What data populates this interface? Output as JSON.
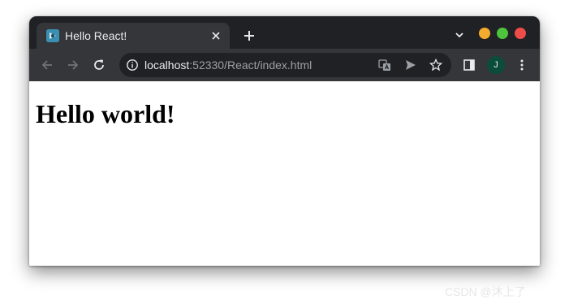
{
  "tab": {
    "title": "Hello React!"
  },
  "address_bar": {
    "host": "localhost",
    "path": ":52330/React/index.html"
  },
  "profile": {
    "initial": "J",
    "color": "#0b4d3a"
  },
  "window_controls": {
    "minimize_color": "#f4ac2f",
    "maximize_color": "#4ec43d",
    "close_color": "#ee4c4a"
  },
  "icons": [
    "react-favicon-icon",
    "close-icon",
    "plus-icon",
    "chevron-down-icon",
    "back-arrow-icon",
    "forward-arrow-icon",
    "reload-icon",
    "info-icon",
    "translate-icon",
    "send-icon",
    "star-icon",
    "side-panel-icon",
    "more-vert-icon"
  ],
  "page": {
    "heading": "Hello world!"
  },
  "watermark": "CSDN @沐上了"
}
